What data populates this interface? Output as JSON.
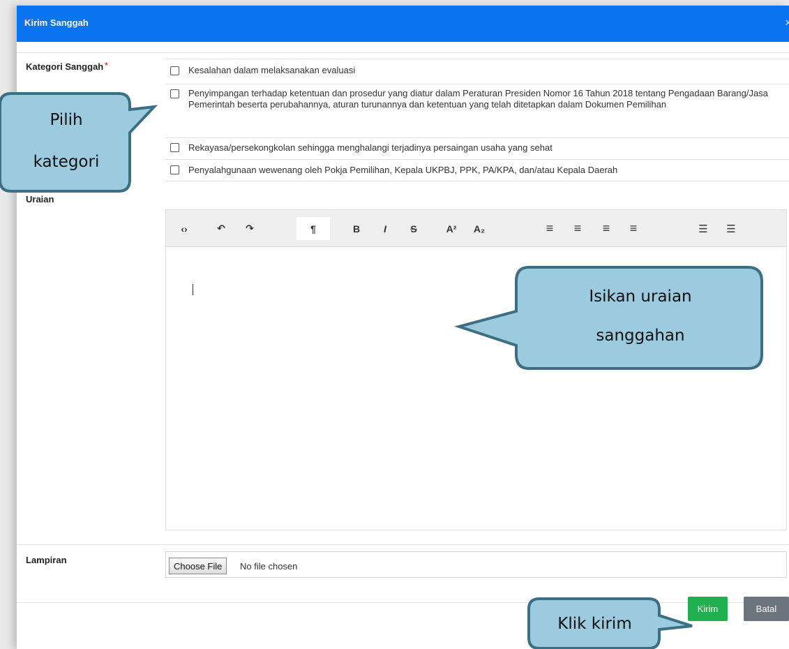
{
  "dialog": {
    "title": "Kirim Sanggah",
    "close": "×"
  },
  "kategori": {
    "label": "Kategori Sanggah",
    "required_mark": "*",
    "options": [
      "Kesalahan dalam melaksanakan evaluasi",
      "Penyimpangan terhadap ketentuan dan prosedur yang diatur dalam Peraturan Presiden Nomor 16 Tahun 2018 tentang Pengadaan Barang/Jasa Pemerintah beserta perubahannya, aturan turunannya dan ketentuan yang telah ditetapkan dalam Dokumen Pemilihan",
      "Rekayasa/persekongkolan sehingga menghalangi terjadinya persaingan usaha yang sehat",
      "Penyalahgunaan wewenang oleh Pokja Pemilihan, Kepala UKPBJ, PPK, PA/KPA, dan/atau Kepala Daerah"
    ]
  },
  "uraian": {
    "label": "Uraian",
    "toolbar": {
      "code": "‹›",
      "undo": "↶",
      "redo": "↷",
      "paragraph": "¶",
      "bold": "B",
      "italic": "I",
      "strike": "S",
      "superscript": "A²",
      "subscript": "A₂",
      "align_left": "≡",
      "align_center": "≡",
      "align_right": "≡",
      "justify": "≡",
      "bullet_list": "☰",
      "numbered_list": "☰"
    },
    "content": ""
  },
  "lampiran": {
    "label": "Lampiran",
    "choose_label": "Choose File",
    "no_file": "No file chosen"
  },
  "actions": {
    "kirim": "Kirim",
    "batal": "Batal"
  },
  "callouts": {
    "kategori": [
      "Pilih",
      "kategori"
    ],
    "uraian": [
      "Isikan uraian",
      "sanggahan"
    ],
    "kirim": "Klik kirim"
  },
  "colors": {
    "header": "#0a73f0",
    "kirim": "#21b04f",
    "batal": "#6c757d",
    "callout_fill": "#9ccbdf",
    "callout_stroke": "#3c6f83"
  }
}
